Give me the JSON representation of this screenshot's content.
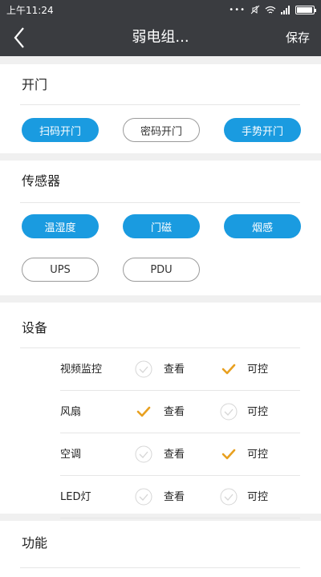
{
  "status_bar": {
    "time": "上午11:24",
    "battery_percent": 95
  },
  "header": {
    "title": "弱电组...",
    "save_label": "保存"
  },
  "colors": {
    "accent": "#1a9be0",
    "check": "#e8a020",
    "header_bg": "#3a3c40"
  },
  "door": {
    "title": "开门",
    "buttons": [
      {
        "label": "扫码开门",
        "active": true
      },
      {
        "label": "密码开门",
        "active": false
      },
      {
        "label": "手势开门",
        "active": true
      }
    ]
  },
  "sensor": {
    "title": "传感器",
    "buttons": [
      {
        "label": "温湿度",
        "active": true
      },
      {
        "label": "门磁",
        "active": true
      },
      {
        "label": "烟感",
        "active": true
      },
      {
        "label": "UPS",
        "active": false
      },
      {
        "label": "PDU",
        "active": false
      }
    ]
  },
  "device": {
    "title": "设备",
    "view_label": "查看",
    "control_label": "可控",
    "rows": [
      {
        "name": "视频监控",
        "view": false,
        "control": true
      },
      {
        "name": "风扇",
        "view": true,
        "control": false
      },
      {
        "name": "空调",
        "view": false,
        "control": true
      },
      {
        "name": "LED灯",
        "view": false,
        "control": false
      }
    ]
  },
  "function": {
    "title": "功能"
  }
}
